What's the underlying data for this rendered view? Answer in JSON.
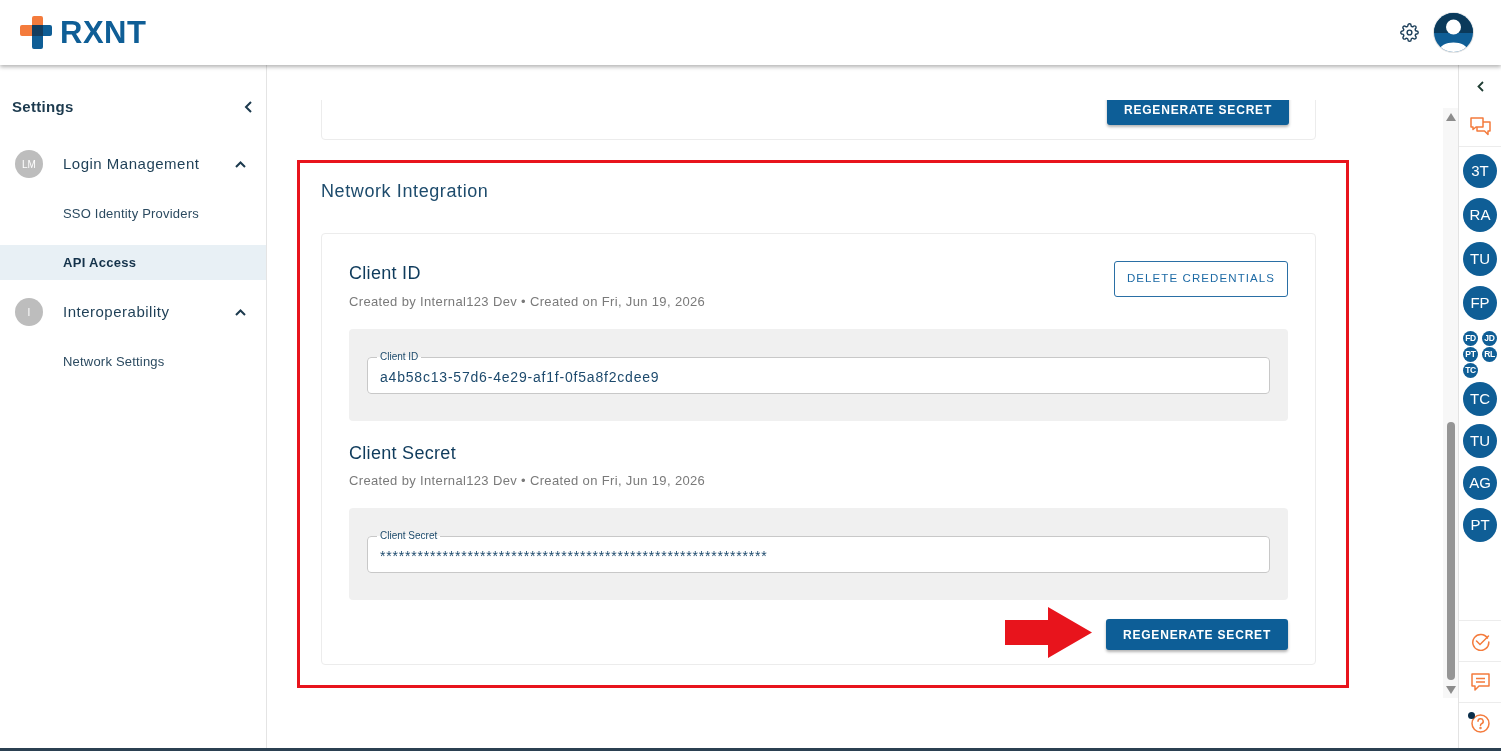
{
  "header": {
    "logo_text": "RXNT"
  },
  "sidebar": {
    "title": "Settings",
    "groups": [
      {
        "initials": "LM",
        "label": "Login Management",
        "expanded": true,
        "children": [
          {
            "label": "SSO Identity Providers",
            "selected": false
          },
          {
            "label": "API Access",
            "selected": true
          }
        ]
      },
      {
        "initials": "I",
        "label": "Interoperability",
        "expanded": true,
        "children": [
          {
            "label": "Network Settings",
            "selected": false
          }
        ]
      }
    ]
  },
  "main": {
    "previous_card": {
      "button": {
        "label": "REGENERATE SECRET",
        "kind": "contained"
      }
    },
    "section": {
      "title": "Network Integration",
      "blocks": [
        {
          "title": "Client ID",
          "meta": "Created by Internal123 Dev • Created on Fri, Jun 19, 2026",
          "field": {
            "label": "Client ID",
            "value": "a4b58c13-57d6-4e29-af1f-0f5a8f2cdee9"
          },
          "button": {
            "label": "DELETE CREDENTIALS",
            "kind": "outlined"
          }
        },
        {
          "title": "Client Secret",
          "meta": "Created by Internal123 Dev • Created on Fri, Jun 19, 2026",
          "field": {
            "label": "Client Secret",
            "value": "**************************************************************"
          }
        }
      ],
      "footer_button": {
        "label": "REGENERATE SECRET",
        "kind": "contained"
      }
    }
  },
  "rail": {
    "items": [
      {
        "kind": "avatar",
        "initials": "3T"
      },
      {
        "kind": "avatar",
        "initials": "RA"
      },
      {
        "kind": "avatar",
        "initials": "TU"
      },
      {
        "kind": "avatar",
        "initials": "FP"
      },
      {
        "kind": "group",
        "members": [
          "FD",
          "JD",
          "PT",
          "RL",
          "TC"
        ]
      },
      {
        "kind": "avatar",
        "initials": "TC"
      },
      {
        "kind": "avatar",
        "initials": "TU"
      },
      {
        "kind": "avatar",
        "initials": "AG"
      },
      {
        "kind": "avatar",
        "initials": "PT"
      }
    ],
    "help_notification": true
  }
}
